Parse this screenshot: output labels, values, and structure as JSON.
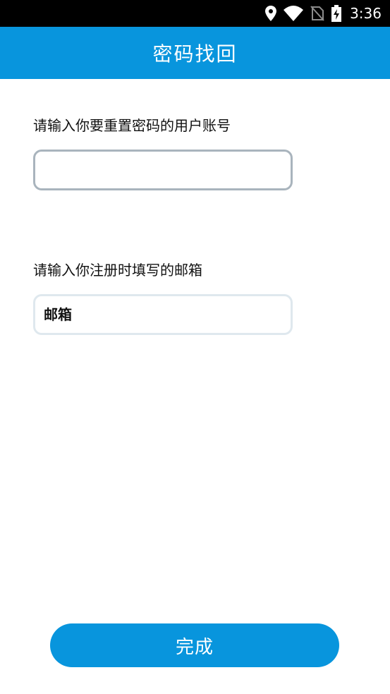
{
  "status_bar": {
    "time": "3:36",
    "icons": [
      "location-icon",
      "wifi-icon",
      "no-sim-icon",
      "battery-charging-icon"
    ]
  },
  "app_bar": {
    "title": "密码找回",
    "color": "#0895dd"
  },
  "form": {
    "username": {
      "label": "请输入你要重置密码的用户账号",
      "value": "",
      "placeholder": ""
    },
    "email": {
      "label": "请输入你注册时填写的邮箱",
      "value": "",
      "placeholder": "邮箱"
    }
  },
  "submit": {
    "label": "完成",
    "color": "#0895dd"
  }
}
